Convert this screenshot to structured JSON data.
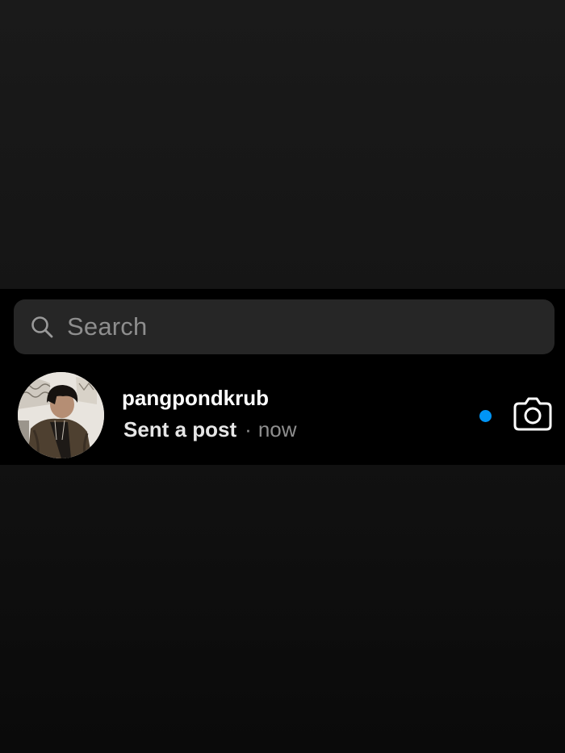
{
  "search": {
    "placeholder": "Search",
    "icon": "search-icon"
  },
  "thread": {
    "username": "pangpondkrub",
    "message_preview": "Sent a post",
    "separator": "·",
    "timestamp": "now",
    "unread": true,
    "action_icon": "camera-icon"
  },
  "colors": {
    "panel_background": "#000000",
    "dimmed_background": "#151515",
    "search_background": "#262626",
    "placeholder_text": "#8e8e8e",
    "unread_dot": "#0095f6",
    "primary_text": "#ffffff"
  }
}
